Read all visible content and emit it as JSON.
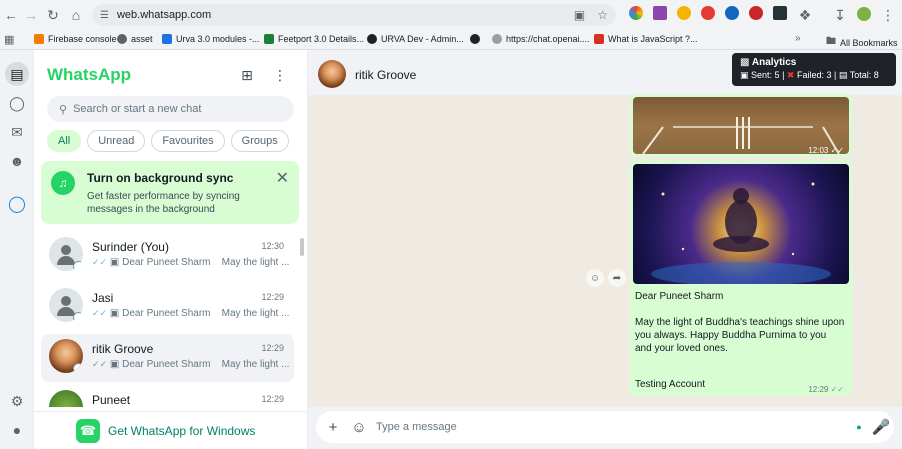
{
  "browser": {
    "url": "web.whatsapp.com",
    "bookmarks": [
      {
        "label": "Firebase console",
        "color": "#f57c00"
      },
      {
        "label": "asset",
        "color": "#5f6368"
      },
      {
        "label": "Urva 3.0 modules -...",
        "color": "#1a73e8"
      },
      {
        "label": "Feetport 3.0 Details...",
        "color": "#188038"
      },
      {
        "label": "URVA Dev - Admin...",
        "color": "#202124"
      },
      {
        "label": "",
        "color": "#202124"
      },
      {
        "label": "https://chat.openai....",
        "color": "#5f6368"
      },
      {
        "label": "What is JavaScript ?...",
        "color": "#d93025"
      }
    ],
    "all_bookmarks": "All Bookmarks"
  },
  "sidebar": {
    "brand": "WhatsApp",
    "search_placeholder": "Search or start a new chat",
    "filters": [
      "All",
      "Unread",
      "Favourites",
      "Groups"
    ],
    "active_filter": "All",
    "banner": {
      "title": "Turn on background sync",
      "text": "Get faster performance by syncing messages in the background"
    },
    "chats": [
      {
        "name": "Surinder (You)",
        "time": "12:30",
        "preview_from": "Dear Puneet Sharm",
        "preview_msg": "May the light ..."
      },
      {
        "name": "Jasi",
        "time": "12:29",
        "preview_from": "Dear Puneet Sharm",
        "preview_msg": "May the light ..."
      },
      {
        "name": "ritik Groove",
        "time": "12:29",
        "preview_from": "Dear Puneet Sharm",
        "preview_msg": "May the light ..."
      },
      {
        "name": "Puneet",
        "time": "12:29",
        "preview_from": "",
        "preview_msg": ""
      }
    ],
    "get_app": "Get WhatsApp for Windows"
  },
  "chat": {
    "contact_name": "ritik Groove",
    "analytics": {
      "title": "Analytics",
      "sent_label": "Sent: 5",
      "failed_label": "Failed: 3",
      "total_label": "Total: 8"
    },
    "messages": [
      {
        "time": "12:03"
      },
      {
        "greeting": "Dear Puneet Sharm",
        "body": "May the light of Buddha's teachings shine upon you always. Happy Buddha Purnima to you and your loved ones.",
        "signature": "Testing Account",
        "time": "12:29"
      }
    ],
    "composer_placeholder": "Type a message"
  },
  "colors": {
    "brand_green": "#25d366",
    "bubble_out": "#d9fdd3",
    "chat_bg": "#efeae2",
    "read_ticks": "#53bdeb"
  }
}
